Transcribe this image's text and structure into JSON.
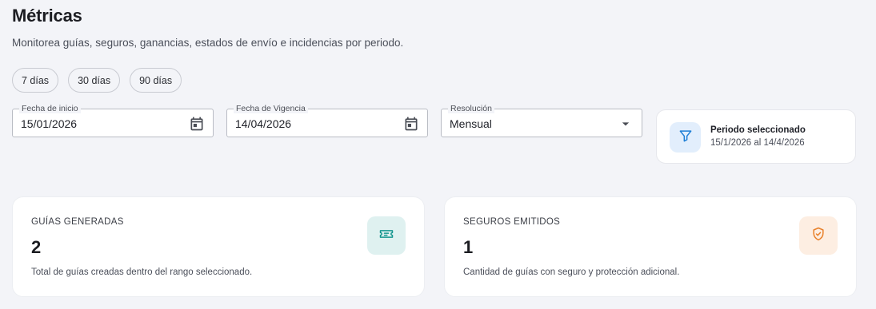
{
  "header": {
    "title": "Métricas",
    "subtitle": "Monitorea guías, seguros, ganancias, estados de envío e incidencias por periodo."
  },
  "range_chips": [
    {
      "label": "7 días"
    },
    {
      "label": "30 días"
    },
    {
      "label": "90 días"
    }
  ],
  "filters": {
    "start_date": {
      "label": "Fecha de inicio",
      "value": "15/01/2026",
      "icon": "calendar-icon"
    },
    "end_date": {
      "label": "Fecha de Vigencia",
      "value": "14/04/2026",
      "icon": "calendar-icon"
    },
    "resolution": {
      "label": "Resolución",
      "value": "Mensual",
      "icon": "dropdown-arrow-icon"
    }
  },
  "period_summary": {
    "title": "Periodo seleccionado",
    "range": "15/1/2026 al 14/4/2026",
    "icon": "filter-icon",
    "icon_color": "#1e7fd6",
    "icon_bg": "#e2eefc"
  },
  "metrics": [
    {
      "label": "GUÍAS GENERADAS",
      "value": "2",
      "description": "Total de guías creadas dentro del rango seleccionado.",
      "icon": "ticket-icon",
      "icon_color": "#16968f",
      "icon_bg": "#dff1f0"
    },
    {
      "label": "SEGUROS EMITIDOS",
      "value": "1",
      "description": "Cantidad de guías con seguro y protección adicional.",
      "icon": "shield-check-icon",
      "icon_color": "#e8802a",
      "icon_bg": "#fdeee2"
    }
  ]
}
